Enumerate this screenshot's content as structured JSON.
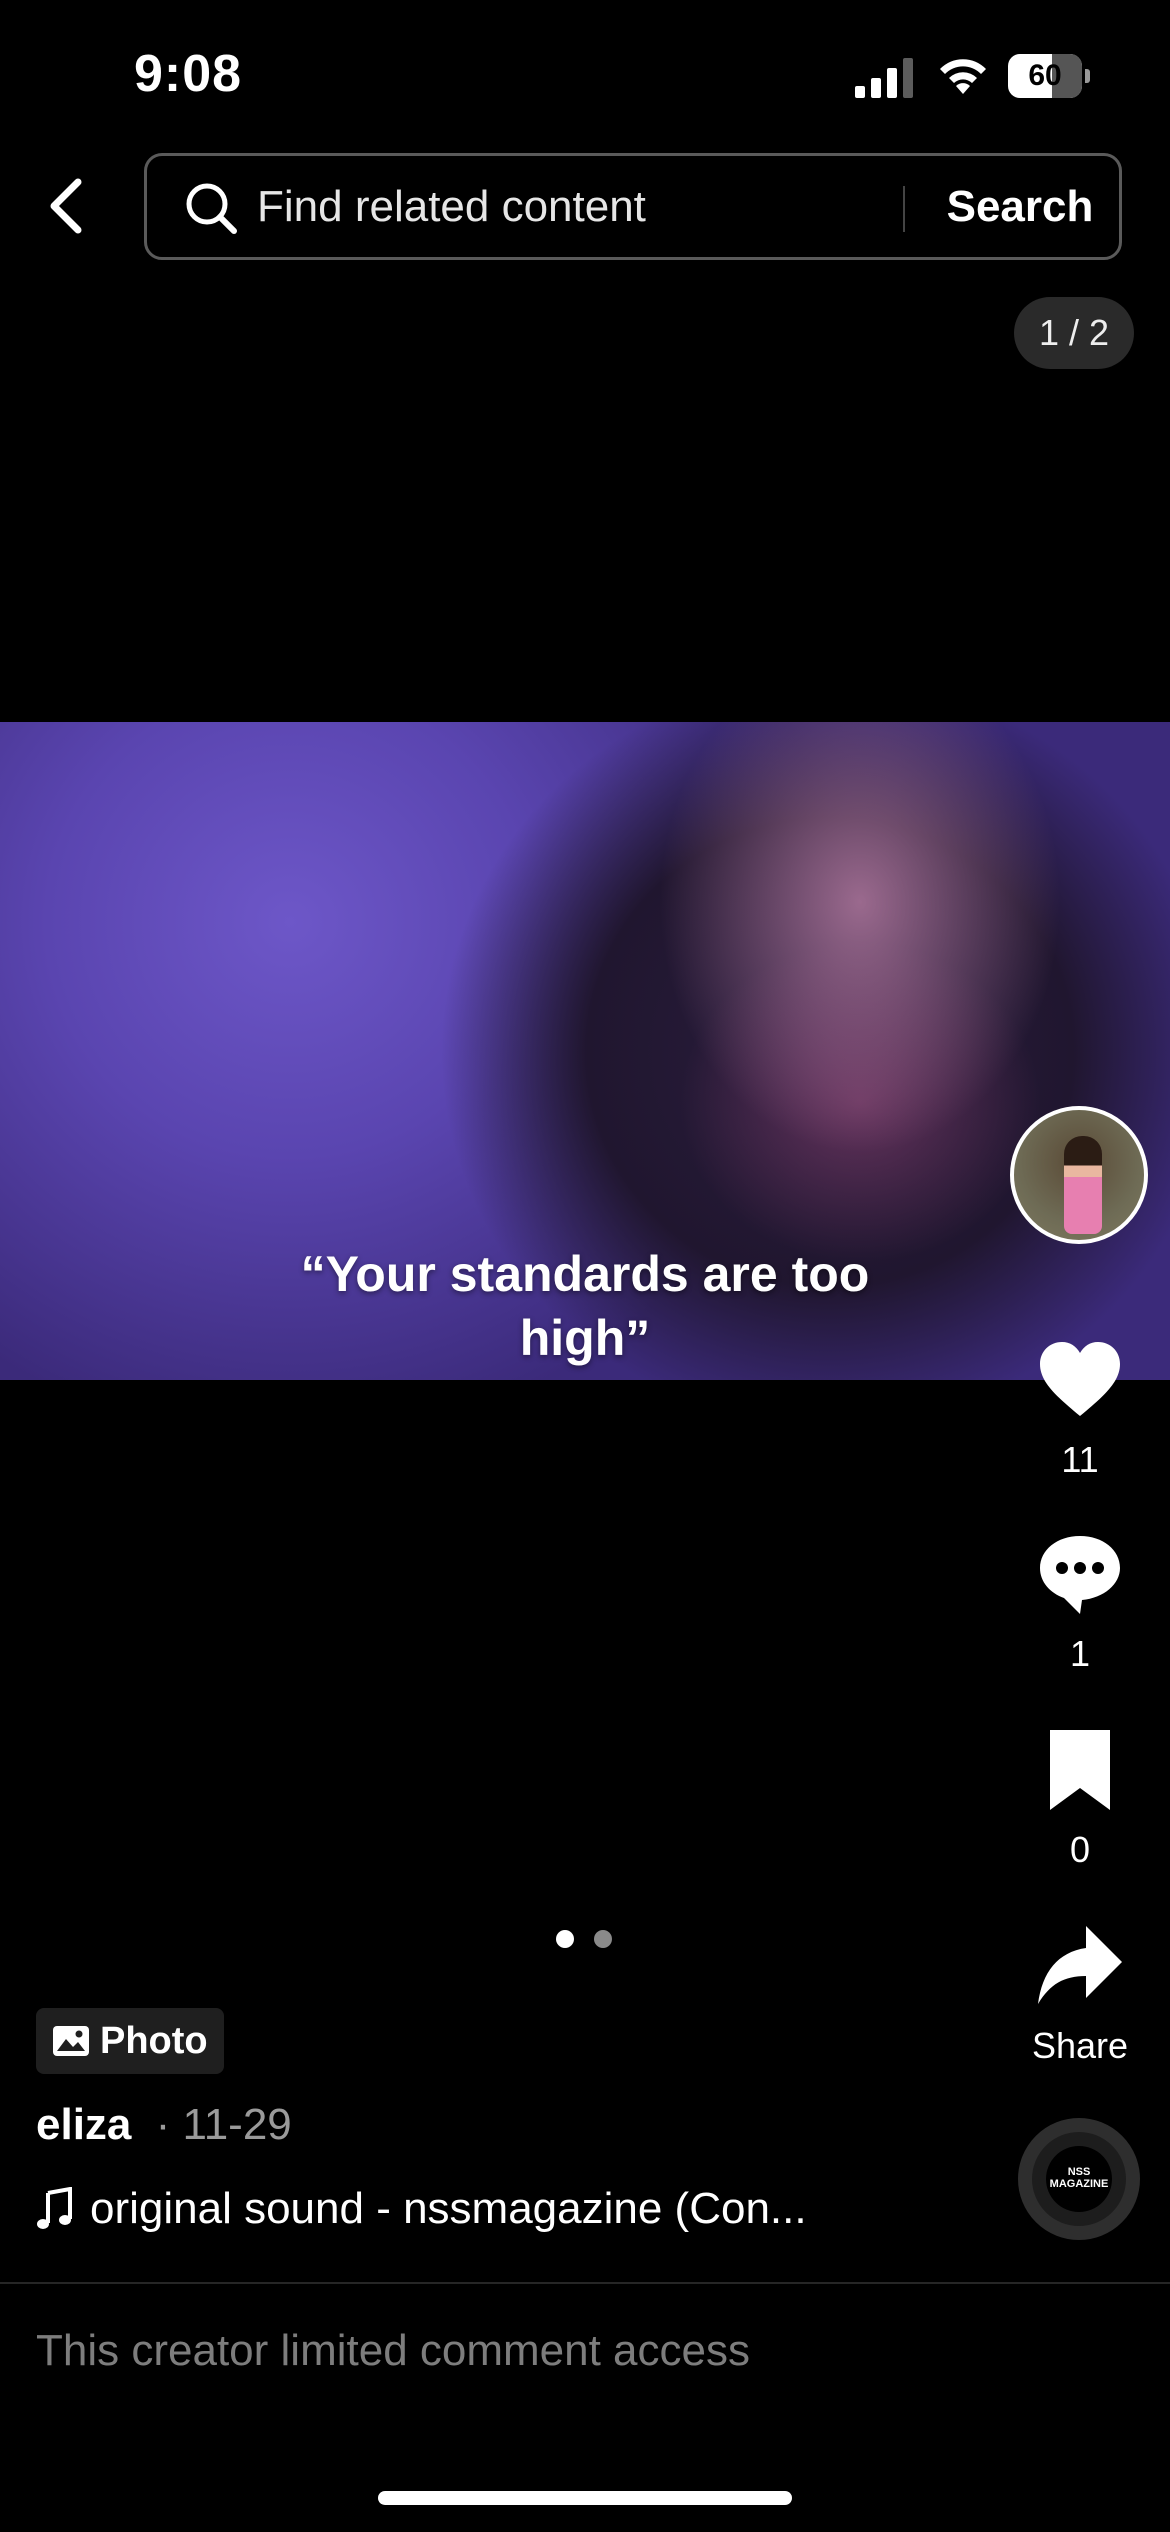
{
  "status_bar": {
    "time": "9:08",
    "battery": "60"
  },
  "search": {
    "placeholder": "Find related content",
    "button_label": "Search"
  },
  "page_counter": "1 / 2",
  "photo": {
    "caption": "“Your standards are too high”"
  },
  "actions": {
    "likes": "11",
    "comments": "1",
    "saves": "0",
    "share_label": "Share"
  },
  "music_disc_text": "NSS MAGAZINE",
  "carousel": {
    "total": 2,
    "active": 1
  },
  "post": {
    "type_label": "Photo",
    "author": "eliza",
    "date": "· 11-29",
    "sound": "original sound - nssmagazine (Con..."
  },
  "comment_notice": "This creator limited comment access"
}
